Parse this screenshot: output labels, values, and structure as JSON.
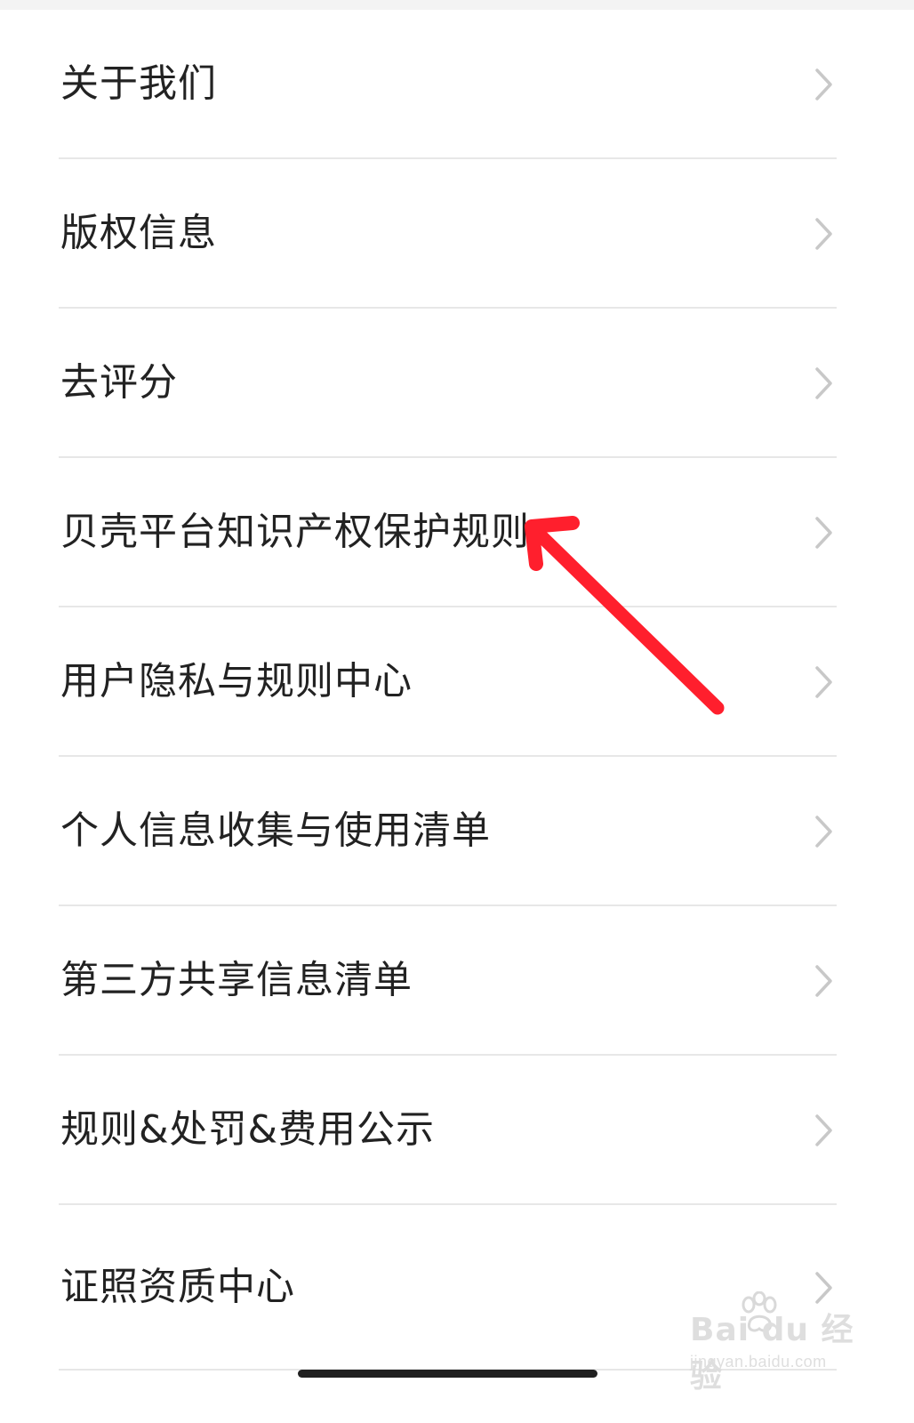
{
  "menu": {
    "items": [
      {
        "label": "关于我们"
      },
      {
        "label": "版权信息"
      },
      {
        "label": "去评分"
      },
      {
        "label": "贝壳平台知识产权保护规则"
      },
      {
        "label": "用户隐私与规则中心"
      },
      {
        "label": "个人信息收集与使用清单"
      },
      {
        "label": "第三方共享信息清单"
      },
      {
        "label": "规则&处罚&费用公示"
      },
      {
        "label": "证照资质中心"
      }
    ]
  },
  "icons": {
    "row_chevron": "chevron-right-icon",
    "annotation": "red-arrow-annotation-icon",
    "watermark_logo": "baidu-paw-icon"
  },
  "watermark": {
    "main": "Bai du 经验",
    "sub": "jingyan.baidu.com"
  },
  "colors": {
    "background": "#ffffff",
    "top_strip": "#f3f3f3",
    "text": "#222222",
    "chevron": "#c8c8c8",
    "divider": "#e7e7e7",
    "annotation_arrow": "#ff1f2d",
    "home_indicator": "#202020"
  }
}
